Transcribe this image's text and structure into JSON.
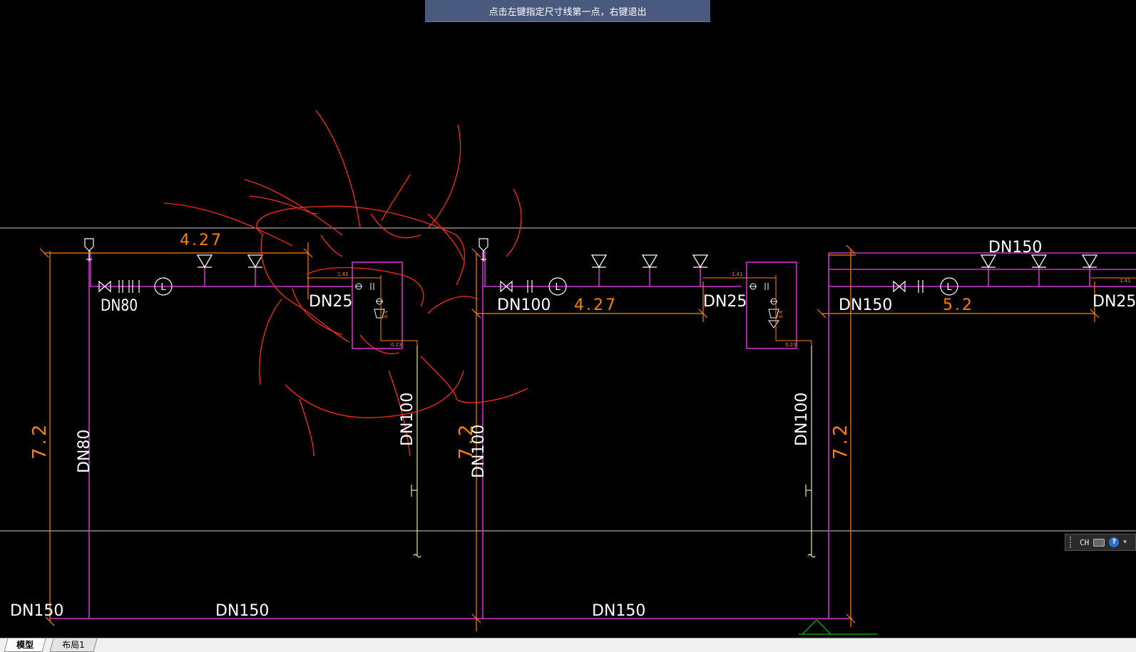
{
  "prompt": "点击左键指定尺寸线第一点，右键退出",
  "drawing": {
    "pipe_labels": [
      "DN80",
      "DN25",
      "DN100",
      "DN25",
      "DN150",
      "DN25",
      "DN150",
      "DN150",
      "DN150",
      "DN150",
      "DN80",
      "DN100",
      "DN100",
      "DN100"
    ],
    "dimension_labels": [
      "4.27",
      "4.27",
      "5.2",
      "7.2",
      "7.2",
      "7.2"
    ],
    "small_dims": [
      "1.41",
      "1.41",
      "1.41",
      "0.23",
      "0.23",
      "3.4",
      "3.4"
    ],
    "colors": {
      "background": "#000000",
      "pipe": "#cc33cc",
      "dimension": "#ff7f00",
      "text": "#ffffff",
      "annotation": "#ff2a1a",
      "drain": "#f0e68c",
      "ucs": "#00c000"
    }
  },
  "ime": {
    "lang": "CH",
    "icons": [
      "grip-icon",
      "keyboard-icon",
      "help-icon",
      "menu-arrow-icon"
    ]
  },
  "tabs": [
    {
      "label": "模型",
      "active": true
    },
    {
      "label": "布局1",
      "active": false
    }
  ]
}
